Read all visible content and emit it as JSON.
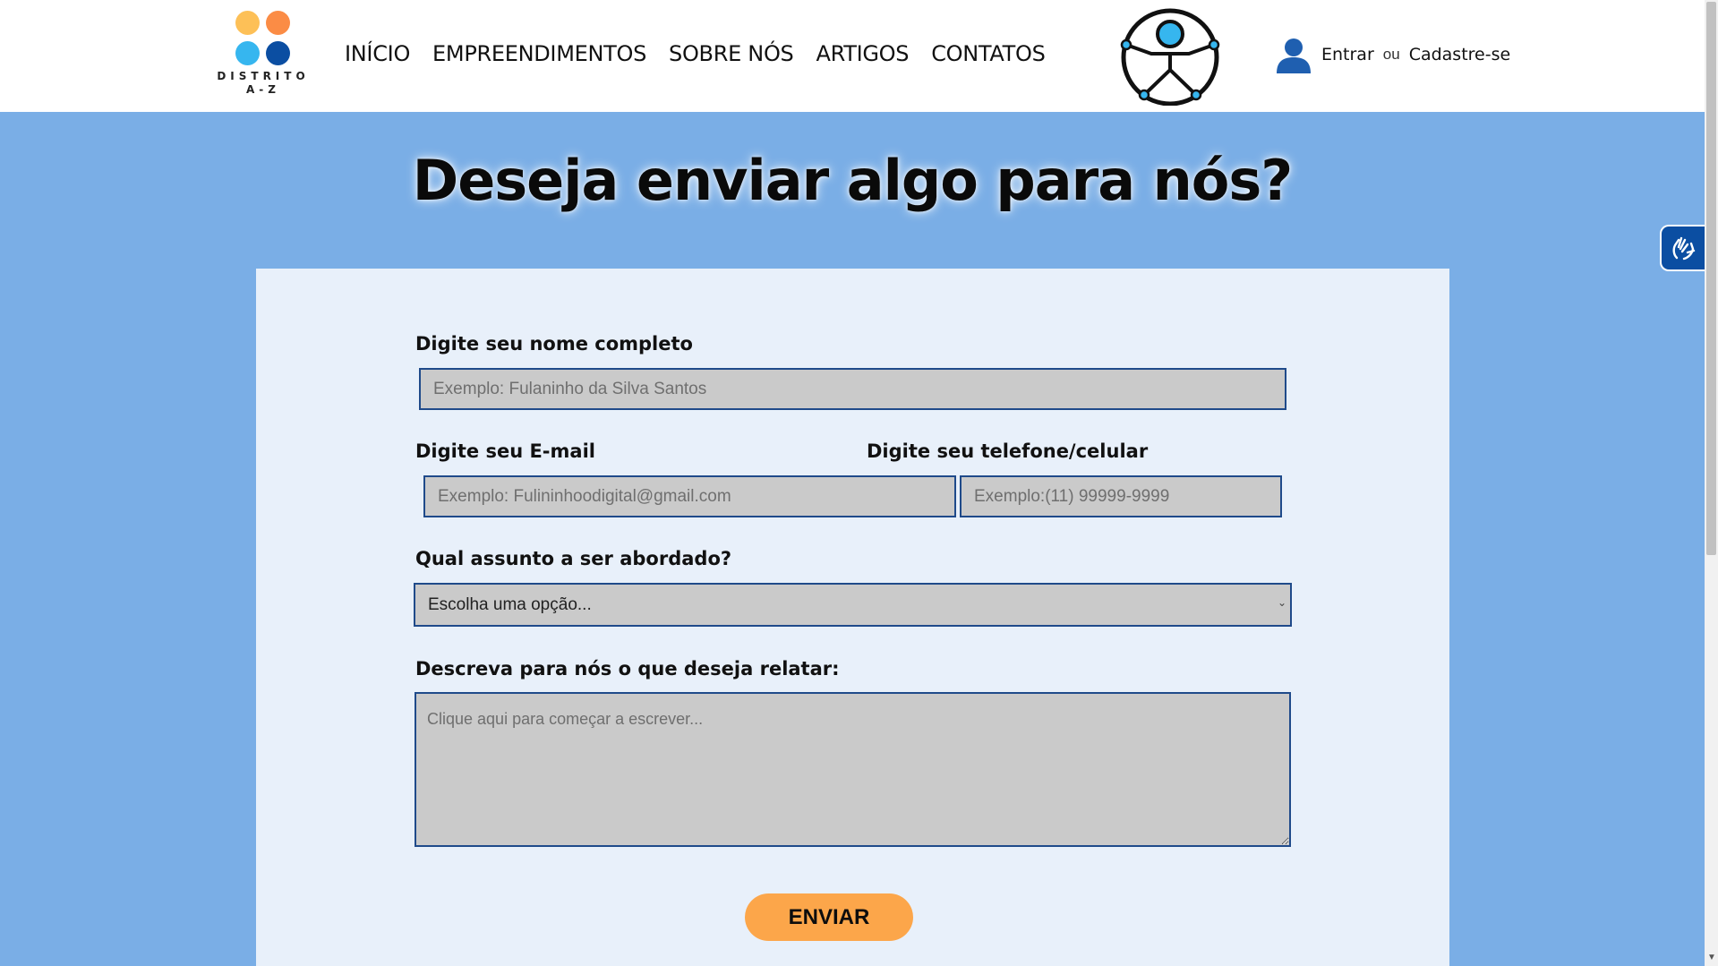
{
  "logo": {
    "wordmark_line1": "DISTRITO",
    "wordmark_line2": "A-Z",
    "dot_colors": [
      "#fdc057",
      "#fb8c45",
      "#36b6ef",
      "#0b4ea2"
    ]
  },
  "nav": {
    "items": [
      {
        "label": "INÍCIO"
      },
      {
        "label": "EMPREENDIMENTOS"
      },
      {
        "label": "SOBRE NÓS"
      },
      {
        "label": "ARTIGOS"
      },
      {
        "label": "CONTATOS"
      }
    ]
  },
  "auth": {
    "login_label": "Entrar",
    "or_label": "ou",
    "signup_label": "Cadastre-se"
  },
  "page": {
    "title": "Deseja enviar algo para nós?"
  },
  "form": {
    "name_label": "Digite seu nome completo",
    "name_placeholder": "Exemplo: Fulaninho da Silva Santos",
    "email_label": "Digite seu E-mail",
    "email_placeholder": "Exemplo: Fulininhoodigital@gmail.com",
    "phone_label": "Digite seu telefone/celular",
    "phone_placeholder": "Exemplo:(11) 99999-9999",
    "subject_label": "Qual assunto a ser abordado?",
    "subject_selected": "Escolha uma opção...",
    "message_label": "Descreva para nós o que deseja relatar:",
    "message_placeholder": "Clique aqui para começar a escrever...",
    "submit_label": "ENVIAR"
  },
  "colors": {
    "background": "#7aaee6",
    "card": "#e8f0fa",
    "field": "#cacaca",
    "field_border": "#1f4a8a",
    "accent": "#fca64a",
    "vlibras": "#0b4ea2"
  },
  "icons": {
    "user": "user-icon",
    "accessibility": "accessibility-icon",
    "vlibras": "sign-language-hands-icon",
    "select_chevron": "chevron-down-icon"
  }
}
